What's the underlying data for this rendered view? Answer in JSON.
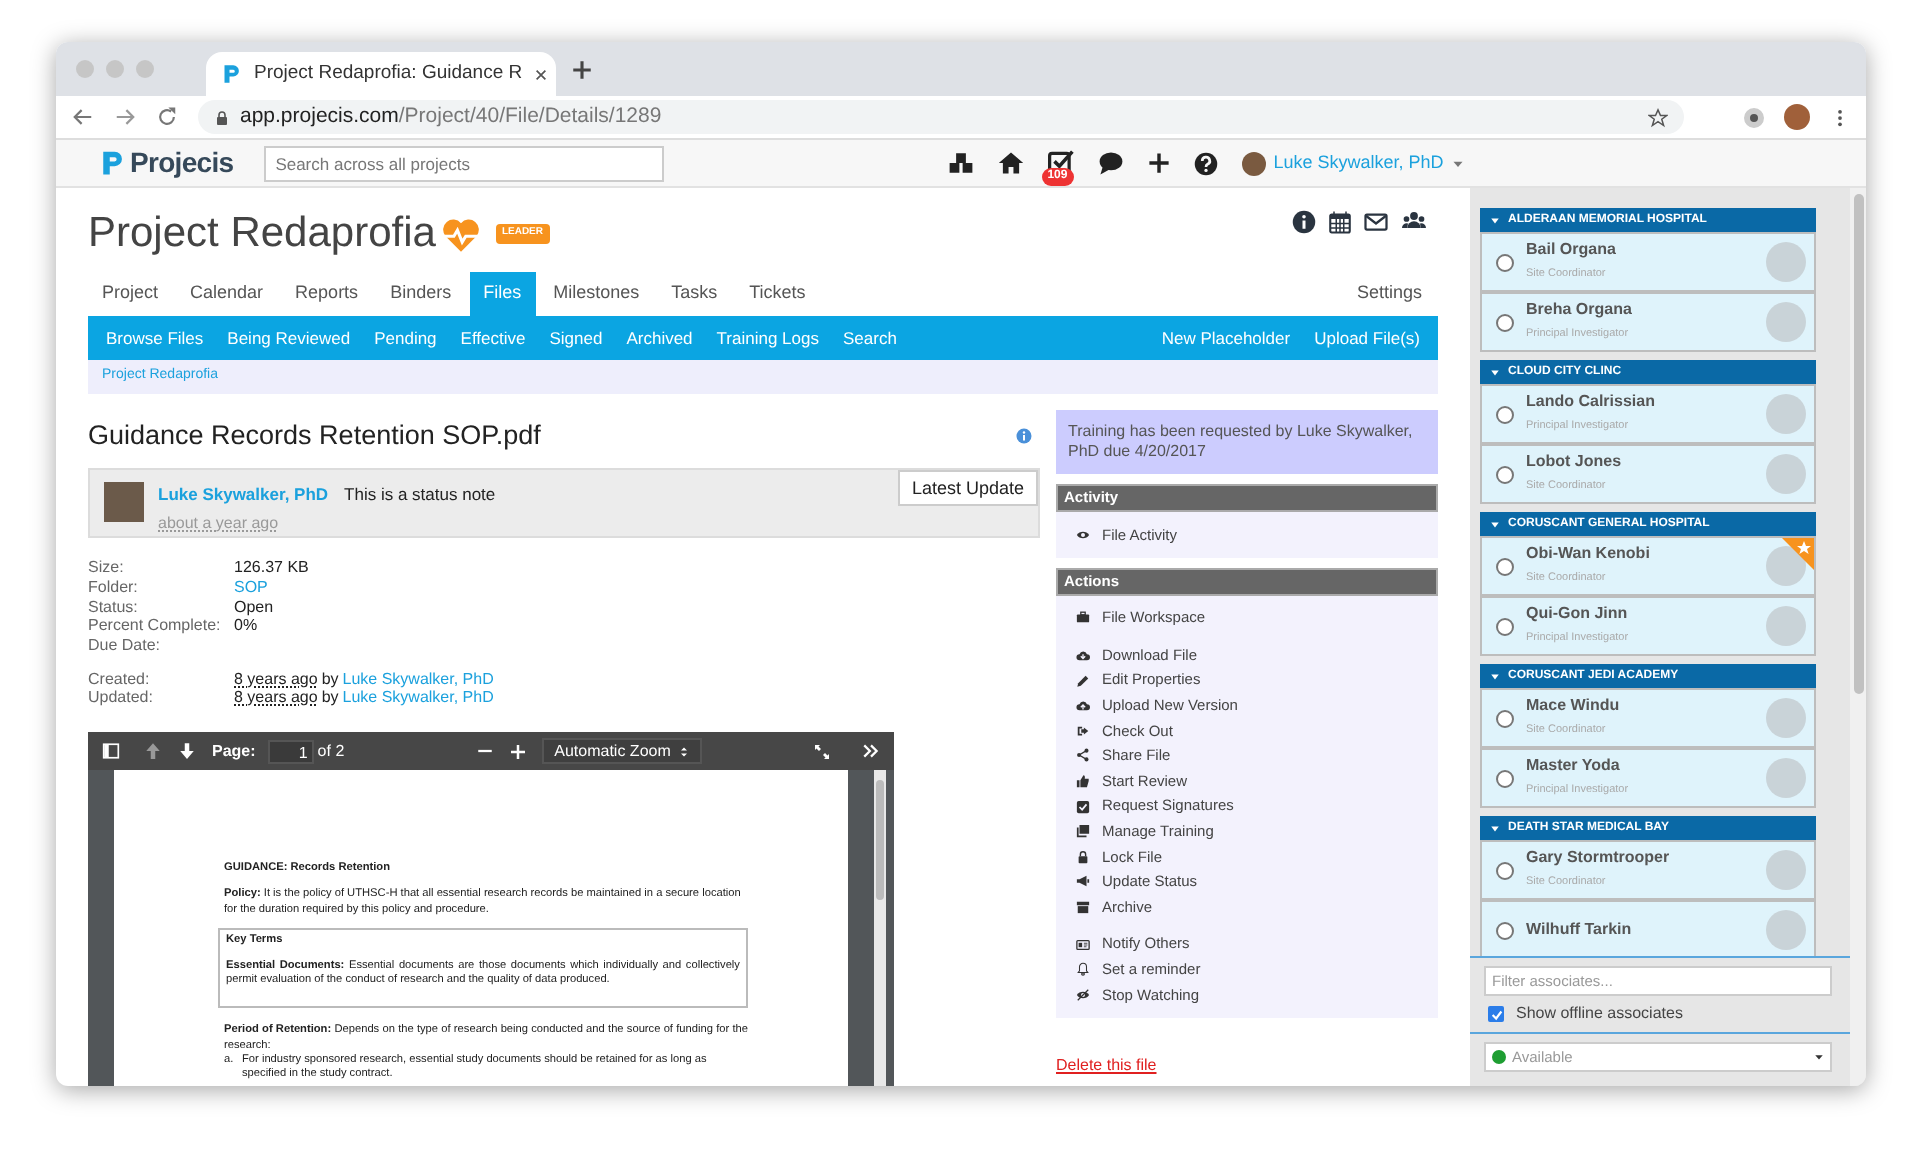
{
  "browser": {
    "tab_title": "Project Redaprofia: Guidance R",
    "url_host": "app.projecis.com",
    "url_path": "/Project/40/File/Details/1289"
  },
  "header": {
    "logo": "Projecis",
    "search_placeholder": "Search across all projects",
    "task_badge": "109",
    "user": "Luke Skywalker, PhD"
  },
  "project": {
    "title": "Project Redaprofia",
    "badge": "LEADER"
  },
  "tabs": [
    {
      "label": "Project",
      "selected": false
    },
    {
      "label": "Calendar",
      "selected": false
    },
    {
      "label": "Reports",
      "selected": false
    },
    {
      "label": "Binders",
      "selected": false
    },
    {
      "label": "Files",
      "selected": true
    },
    {
      "label": "Milestones",
      "selected": false
    },
    {
      "label": "Tasks",
      "selected": false
    },
    {
      "label": "Tickets",
      "selected": false
    }
  ],
  "settings": "Settings",
  "subnav": {
    "items": [
      "Browse Files",
      "Being Reviewed",
      "Pending",
      "Effective",
      "Signed",
      "Archived",
      "Training Logs",
      "Search"
    ],
    "right_items": [
      "New Placeholder",
      "Upload File(s)"
    ]
  },
  "breadcrumb": "Project Redaprofia",
  "file": {
    "title": "Guidance Records Retention SOP.pdf",
    "status_note": {
      "author": "Luke Skywalker, PhD",
      "text": "This is a status note",
      "time": "about a year ago",
      "button": "Latest Update"
    },
    "properties": [
      {
        "label": "Size:",
        "value": "126.37 KB",
        "kind": "text"
      },
      {
        "label": "Folder:",
        "value": "SOP",
        "kind": "link"
      },
      {
        "label": "Status:",
        "value": "Open",
        "kind": "text"
      },
      {
        "label": "Percent Complete:",
        "value": "0%",
        "kind": "text"
      },
      {
        "label": "Due Date:",
        "kind": "text"
      }
    ],
    "history": [
      {
        "label": "Created:",
        "time": "8 years ago",
        "by": "by",
        "user": "Luke Skywalker, PhD"
      },
      {
        "label": "Updated:",
        "time": "8 years ago",
        "by": "by",
        "user": "Luke Skywalker, PhD"
      }
    ]
  },
  "pdf_viewer": {
    "page_label": "Page:",
    "page": "1",
    "page_count": "of 2",
    "zoom": "Automatic Zoom",
    "document": {
      "heading": "GUIDANCE: Records Retention",
      "policy": "**Policy:** It is the policy of UTHSC-H that all essential research records be maintained in a secure location for the duration required by this policy and procedure.",
      "key_terms_title": "Key Terms",
      "key_terms_text": "**Essential Documents:** Essential documents are those documents which individually and collectively permit evaluation of the conduct of research and the quality of data produced.",
      "retention": "**Period of Retention:** Depends on the type of research being conducted and the source of funding for the research:",
      "list": [
        {
          "marker": "a.",
          "text": "For industry sponsored research, essential study documents should be retained for as long as specified in the study contract."
        }
      ]
    }
  },
  "notice": "Training has been requested by Luke Skywalker, PhD due 4/20/2017",
  "activity": {
    "title": "Activity",
    "items": [
      "File Activity"
    ]
  },
  "actions": {
    "title": "Actions",
    "groups": [
      [
        "File Workspace"
      ],
      [
        "Download File",
        "Edit Properties",
        "Upload New Version",
        "Check Out",
        "Share File",
        "Start Review",
        "Request Signatures",
        "Manage Training",
        "Lock File",
        "Update Status",
        "Archive"
      ],
      [
        "Notify Others",
        "Set a reminder",
        "Stop Watching"
      ]
    ]
  },
  "delete_link": "Delete this file",
  "associates": {
    "groups": [
      {
        "name": "ALDERAAN MEMORIAL HOSPITAL",
        "expanded": true,
        "members": [
          {
            "name": "Bail Organa",
            "role": "Site Coordinator",
            "selected": false,
            "featured": false
          },
          {
            "name": "Breha Organa",
            "role": "Principal Investigator",
            "selected": false,
            "featured": false
          }
        ]
      },
      {
        "name": "CLOUD CITY CLINC",
        "expanded": true,
        "members": [
          {
            "name": "Lando Calrissian",
            "role": "Principal Investigator",
            "selected": false,
            "featured": false
          },
          {
            "name": "Lobot Jones",
            "role": "Site Coordinator",
            "selected": false,
            "featured": false
          }
        ]
      },
      {
        "name": "CORUSCANT GENERAL HOSPITAL",
        "expanded": true,
        "members": [
          {
            "name": "Obi-Wan Kenobi",
            "role": "Site Coordinator",
            "selected": false,
            "featured": true
          },
          {
            "name": "Qui-Gon Jinn",
            "role": "Principal Investigator",
            "selected": false,
            "featured": false
          }
        ]
      },
      {
        "name": "CORUSCANT JEDI ACADEMY",
        "expanded": true,
        "members": [
          {
            "name": "Mace Windu",
            "role": "Site Coordinator",
            "selected": false,
            "featured": false
          },
          {
            "name": "Master Yoda",
            "role": "Principal Investigator",
            "selected": false,
            "featured": false
          }
        ]
      },
      {
        "name": "DEATH STAR MEDICAL BAY",
        "expanded": true,
        "members": [
          {
            "name": "Gary Stormtrooper",
            "role": "Site Coordinator",
            "selected": false,
            "featured": false
          },
          {
            "name": "Wilhuff Tarkin",
            "selected": false,
            "featured": false
          }
        ]
      }
    ],
    "filter_placeholder": "Filter associates...",
    "show_offline": {
      "label": "Show offline associates",
      "checked": true
    },
    "status": {
      "label": "Available",
      "color": "#1e9e32"
    }
  }
}
